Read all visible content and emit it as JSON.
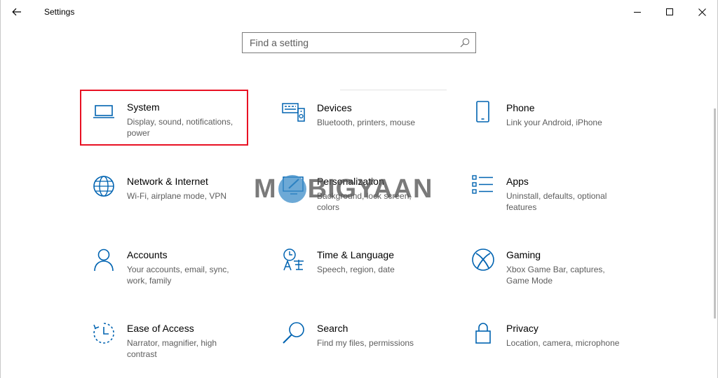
{
  "window": {
    "title": "Settings",
    "controls": {
      "minimize": "minimize",
      "maximize": "maximize",
      "close": "close"
    }
  },
  "search": {
    "placeholder": "Find a setting",
    "value": ""
  },
  "tiles": [
    {
      "title": "System",
      "desc": "Display, sound, notifications, power",
      "icon": "laptop-icon",
      "selected": true
    },
    {
      "title": "Devices",
      "desc": "Bluetooth, printers, mouse",
      "icon": "keyboard-speaker-icon"
    },
    {
      "title": "Phone",
      "desc": "Link your Android, iPhone",
      "icon": "phone-icon"
    },
    {
      "title": "Network & Internet",
      "desc": "Wi-Fi, airplane mode, VPN",
      "icon": "globe-icon"
    },
    {
      "title": "Personalization",
      "desc": "Background, lock screen, colors",
      "icon": "paint-brush-icon"
    },
    {
      "title": "Apps",
      "desc": "Uninstall, defaults, optional features",
      "icon": "apps-list-icon"
    },
    {
      "title": "Accounts",
      "desc": "Your accounts, email, sync, work, family",
      "icon": "person-icon"
    },
    {
      "title": "Time & Language",
      "desc": "Speech, region, date",
      "icon": "time-language-icon"
    },
    {
      "title": "Gaming",
      "desc": "Xbox Game Bar, captures, Game Mode",
      "icon": "xbox-icon"
    },
    {
      "title": "Ease of Access",
      "desc": "Narrator, magnifier, high contrast",
      "icon": "ease-of-access-icon"
    },
    {
      "title": "Search",
      "desc": "Find my files, permissions",
      "icon": "search-icon"
    },
    {
      "title": "Privacy",
      "desc": "Location, camera, microphone",
      "icon": "lock-icon"
    }
  ],
  "watermark": {
    "text_left": "M",
    "text_right": "BIGYAAN"
  },
  "colors": {
    "accent": "#0063b1",
    "selection": "#e81123",
    "secondary_text": "#5d5d5d"
  }
}
